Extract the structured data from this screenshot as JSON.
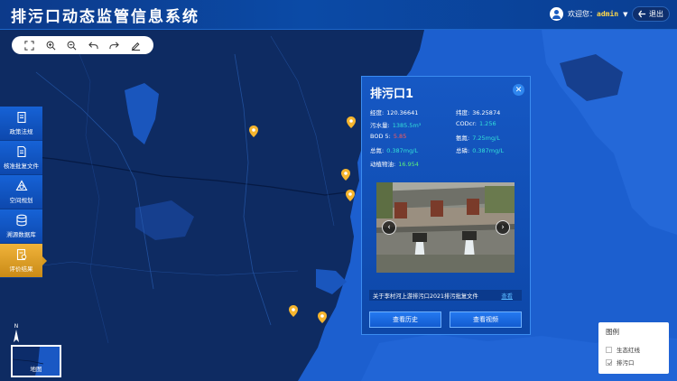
{
  "header": {
    "title": "排污口动态监管信息系统",
    "welcome": "欢迎您：",
    "username": "admin",
    "logout_label": "退出"
  },
  "toolbar": {
    "tools": [
      "fullscreen-icon",
      "zoom-in-icon",
      "zoom-out-icon",
      "undo-icon",
      "redo-icon",
      "edit-icon"
    ]
  },
  "sidebar": {
    "items": [
      {
        "label": "政策法规",
        "icon": "document-icon"
      },
      {
        "label": "核准批复文件",
        "icon": "file-icon"
      },
      {
        "label": "空间规划",
        "icon": "plan-icon"
      },
      {
        "label": "溯源数据库",
        "icon": "database-icon"
      },
      {
        "label": "评价结果",
        "icon": "evaluation-icon",
        "active": true
      }
    ]
  },
  "popup": {
    "title": "排污口1",
    "fields": {
      "longitude_label": "经度:",
      "longitude": "120.36641",
      "latitude_label": "纬度:",
      "latitude": "36.25874",
      "sewage_label": "污水量:",
      "sewage": "1385.5m³",
      "cod_label": "CODcr:",
      "cod": "1.256",
      "bod_label": "BOD 5:",
      "bod": "5.85",
      "ammonia_label": "氨氮:",
      "ammonia": "7.25mg/L",
      "tn_label": "总氮:",
      "tn": "0.387mg/L",
      "tp_label": "总磷:",
      "tp": "0.387mg/L",
      "oil_label": "动植物油:",
      "oil": "16.954"
    },
    "file_text": "关于李村河上游排污口2021排污批复文件",
    "file_link": "查看",
    "history_button": "查看历史",
    "video_button": "查看视频"
  },
  "legend": {
    "title": "图例",
    "items": [
      {
        "label": "生态红线",
        "checked": false
      },
      {
        "label": "排污口",
        "checked": true
      }
    ]
  },
  "basemap": {
    "label": "地图",
    "north": "N"
  },
  "colors": {
    "accent": "#1662d6",
    "active": "#f0b33a",
    "pin": "#f5b52e",
    "cyan_value": "#32e0d8",
    "red_value": "#ff5a5a",
    "green_value": "#5ef07a"
  }
}
